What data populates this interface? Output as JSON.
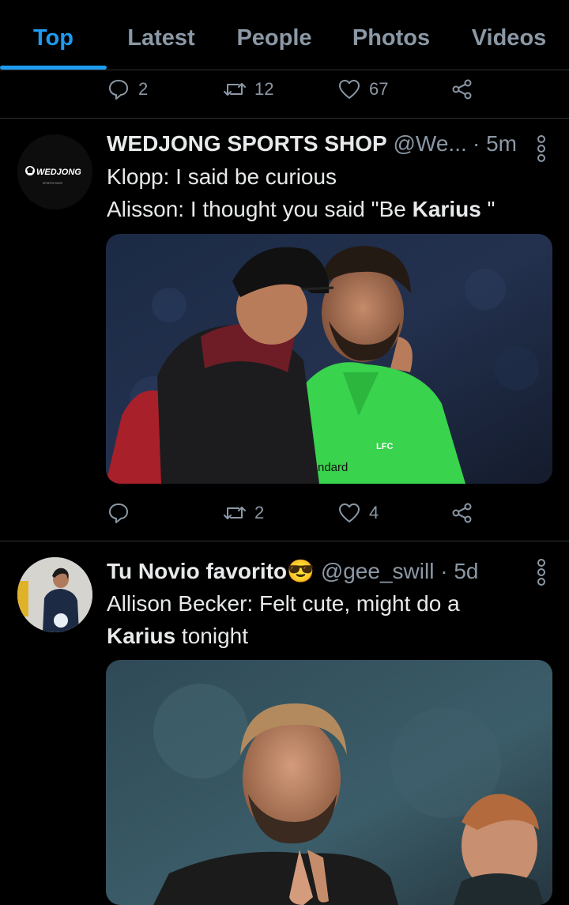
{
  "tabs": [
    {
      "label": "Top"
    },
    {
      "label": "Latest"
    },
    {
      "label": "People"
    },
    {
      "label": "Photos"
    },
    {
      "label": "Videos"
    }
  ],
  "prev_tweet_actions": {
    "replies": "2",
    "retweets": "12",
    "likes": "67"
  },
  "tweets": [
    {
      "display_name": "WEDJONG SPORTS SHOP",
      "handle": "@We...",
      "separator": "·",
      "time": "5m",
      "avatar_text": "WEDJONG",
      "avatar_subtext": "SPORTS SHOP",
      "line1": "Klopp: I said be curious",
      "line2_prefix": "Alisson: I thought you said \"Be ",
      "line2_bold": "Karius",
      "line2_suffix": " \"",
      "image_text": "LFC",
      "image_text2": "ndard",
      "actions": {
        "replies": "",
        "retweets": "2",
        "likes": "4"
      }
    },
    {
      "display_name": "Tu Novio favorito",
      "emoji": "😎",
      "handle": "@gee_swill",
      "separator": "·",
      "time": "5d",
      "line1": "Allison Becker: Felt cute, might do a",
      "line2_bold": "Karius",
      "line2_suffix": " tonight"
    }
  ],
  "colors": {
    "accent": "#1d9bf0",
    "muted": "#8b98a5",
    "background": "#000000",
    "divider": "#2f3336"
  }
}
